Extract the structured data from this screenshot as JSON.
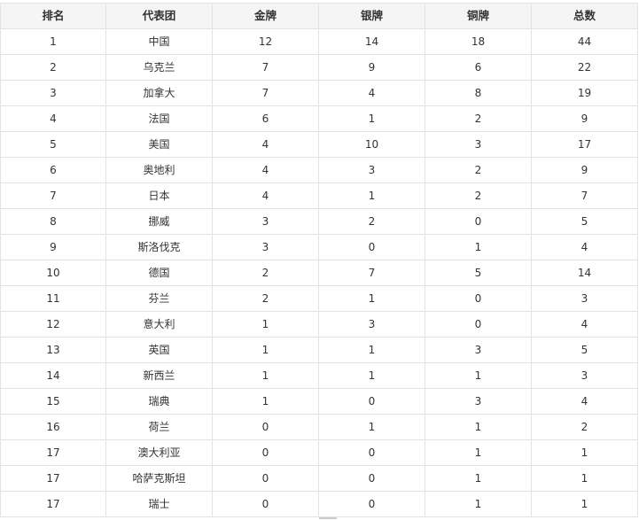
{
  "table": {
    "headers": [
      "排名",
      "代表团",
      "金牌",
      "银牌",
      "铜牌",
      "总数"
    ],
    "rows": [
      [
        "1",
        "中国",
        "12",
        "14",
        "18",
        "44"
      ],
      [
        "2",
        "乌克兰",
        "7",
        "9",
        "6",
        "22"
      ],
      [
        "3",
        "加拿大",
        "7",
        "4",
        "8",
        "19"
      ],
      [
        "4",
        "法国",
        "6",
        "1",
        "2",
        "9"
      ],
      [
        "5",
        "美国",
        "4",
        "10",
        "3",
        "17"
      ],
      [
        "6",
        "奥地利",
        "4",
        "3",
        "2",
        "9"
      ],
      [
        "7",
        "日本",
        "4",
        "1",
        "2",
        "7"
      ],
      [
        "8",
        "挪威",
        "3",
        "2",
        "0",
        "5"
      ],
      [
        "9",
        "斯洛伐克",
        "3",
        "0",
        "1",
        "4"
      ],
      [
        "10",
        "德国",
        "2",
        "7",
        "5",
        "14"
      ],
      [
        "11",
        "芬兰",
        "2",
        "1",
        "0",
        "3"
      ],
      [
        "12",
        "意大利",
        "1",
        "3",
        "0",
        "4"
      ],
      [
        "13",
        "英国",
        "1",
        "1",
        "3",
        "5"
      ],
      [
        "14",
        "新西兰",
        "1",
        "1",
        "1",
        "3"
      ],
      [
        "15",
        "瑞典",
        "1",
        "0",
        "3",
        "4"
      ],
      [
        "16",
        "荷兰",
        "0",
        "1",
        "1",
        "2"
      ],
      [
        "17",
        "澳大利亚",
        "0",
        "0",
        "1",
        "1"
      ],
      [
        "17",
        "哈萨克斯坦",
        "0",
        "0",
        "1",
        "1"
      ],
      [
        "17",
        "瑞士",
        "0",
        "0",
        "1",
        "1"
      ]
    ]
  },
  "colors": {
    "header_bg": "#f5f5f5",
    "border": "#e3e3e3",
    "text": "#333333"
  }
}
